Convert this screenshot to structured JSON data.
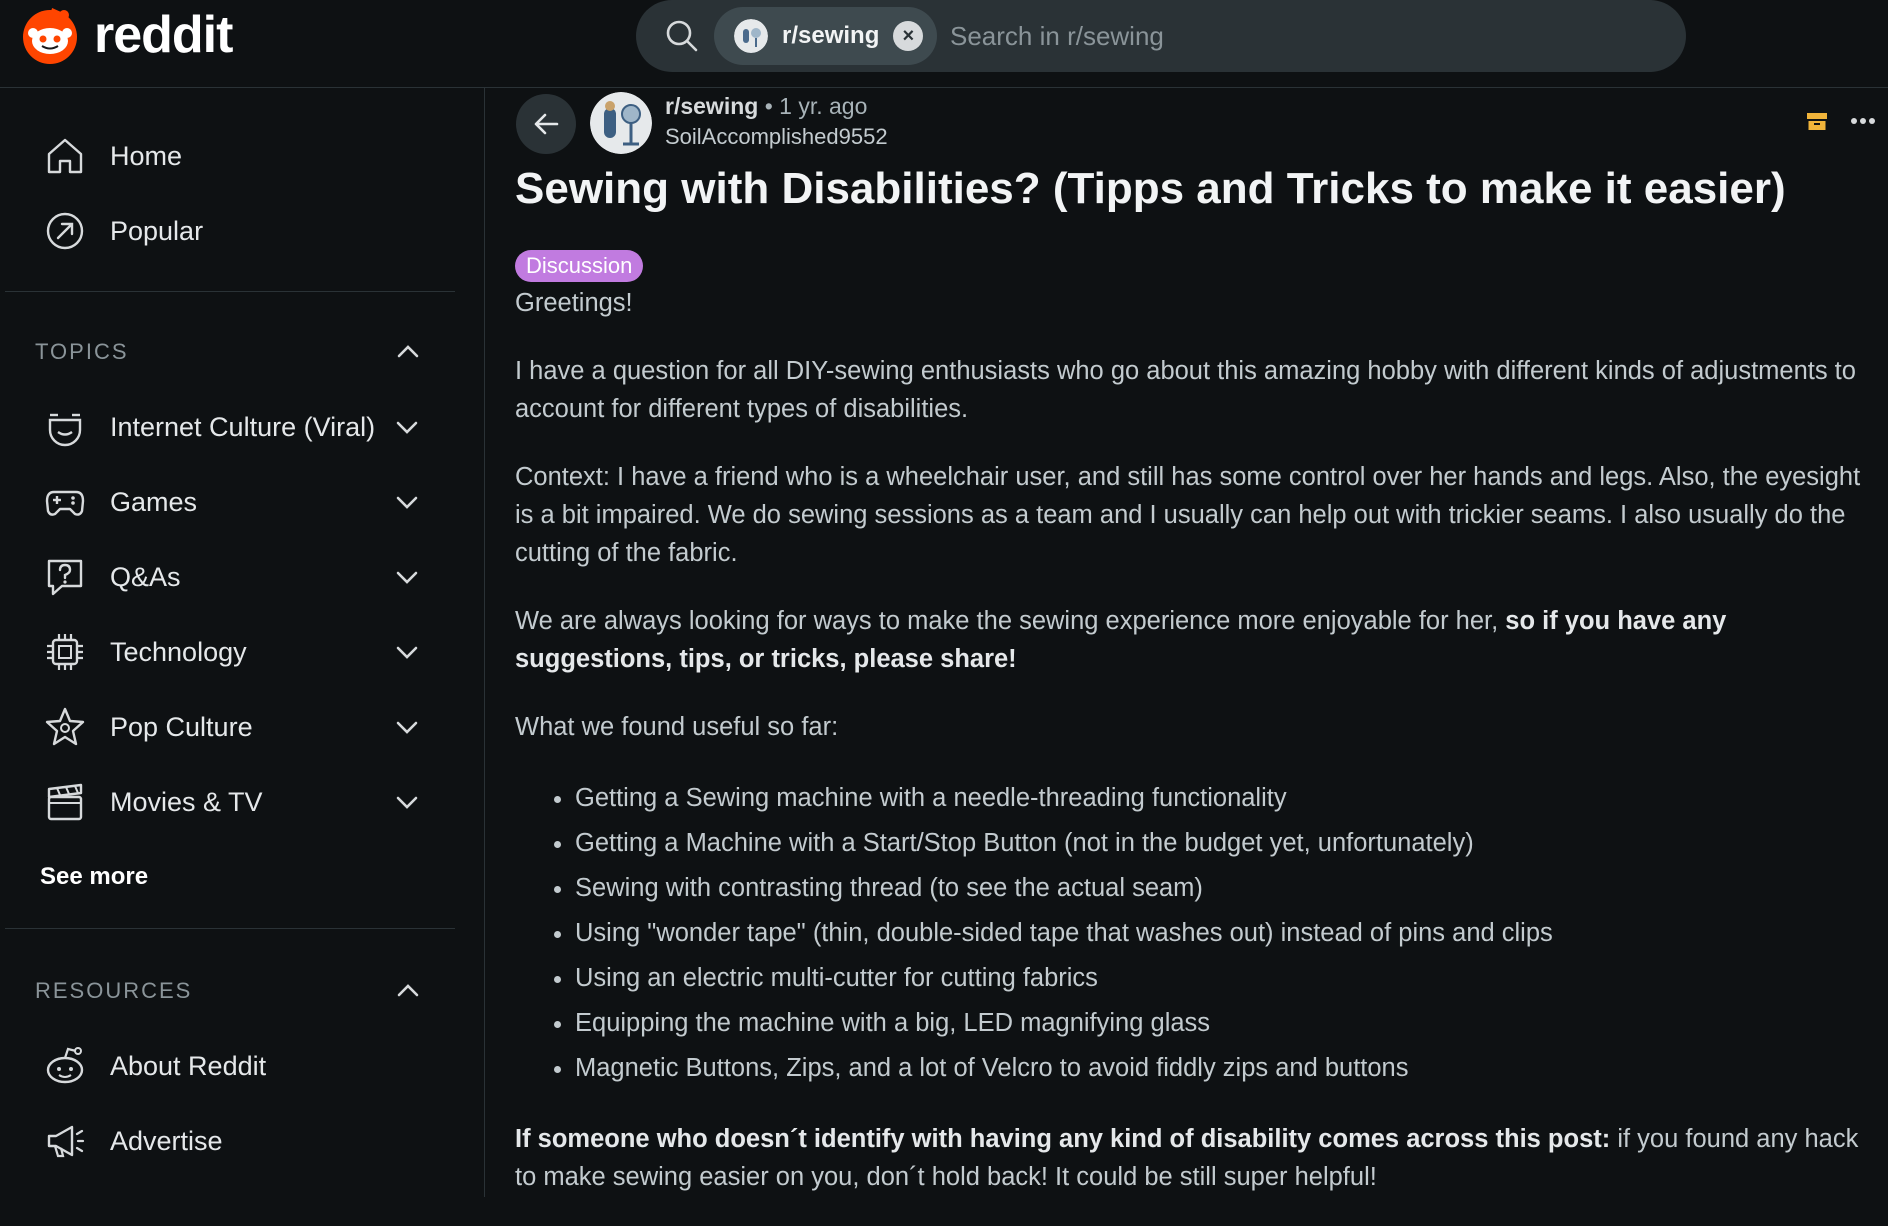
{
  "header": {
    "logo_text": "reddit",
    "search_chip": "r/sewing",
    "search_placeholder": "Search in r/sewing"
  },
  "sidebar": {
    "nav": [
      {
        "label": "Home",
        "icon": "home-icon"
      },
      {
        "label": "Popular",
        "icon": "popular-icon"
      }
    ],
    "topics_title": "TOPICS",
    "topics": [
      {
        "label": "Internet Culture (Viral)",
        "icon": "internet-culture-icon"
      },
      {
        "label": "Games",
        "icon": "gamepad-icon"
      },
      {
        "label": "Q&As",
        "icon": "question-icon"
      },
      {
        "label": "Technology",
        "icon": "chip-icon"
      },
      {
        "label": "Pop Culture",
        "icon": "star-icon"
      },
      {
        "label": "Movies & TV",
        "icon": "clapperboard-icon"
      }
    ],
    "see_more": "See more",
    "resources_title": "RESOURCES",
    "resources": [
      {
        "label": "About Reddit",
        "icon": "reddit-alien-icon"
      },
      {
        "label": "Advertise",
        "icon": "megaphone-icon"
      }
    ]
  },
  "post": {
    "subreddit": "r/sewing",
    "separator": "•",
    "age": "1 yr. ago",
    "author": "SoilAccomplished9552",
    "title": "Sewing with Disabilities? (Tipps and Tricks to make it easier)",
    "flair": "Discussion",
    "greeting": "Greetings!",
    "para1": "I have a question for all DIY-sewing enthusiasts who go about this amazing hobby with different kinds of adjustments to account for different types of disabilities.",
    "para2": "Context: I have a friend who is a wheelchair user, and still has some control over her hands and legs. Also, the eyesight is a bit impaired. We do sewing sessions as a team and I usually can help out with trickier seams. I also usually do the cutting of the fabric.",
    "para3_plain": "We are always looking for ways to make the sewing experience more enjoyable for her, ",
    "para3_bold": "so if you have any suggestions, tips, or tricks, please share!",
    "para4": "What we found useful so far:",
    "list": [
      "Getting a Sewing machine with a needle-threading functionality",
      "Getting a Machine with a Start/Stop Button (not in the budget yet, unfortunately)",
      "Sewing with contrasting thread (to see the actual seam)",
      "Using \"wonder tape\" (thin, double-sided tape that washes out) instead of pins and clips",
      "Using an electric multi-cutter for cutting fabrics",
      "Equipping the machine with a big, LED magnifying glass",
      "Magnetic Buttons, Zips, and a lot of Velcro to avoid fiddly zips and buttons"
    ],
    "para5_bold": "If someone who doesn´t identify with having any kind of disability comes across this post:",
    "para5_plain": " if you found any hack to make sewing easier on you, don´t hold back! It could be still super helpful!"
  },
  "colors": {
    "background": "#0e1113",
    "flair": "#c17be0",
    "reddit_orange": "#ff4500"
  }
}
